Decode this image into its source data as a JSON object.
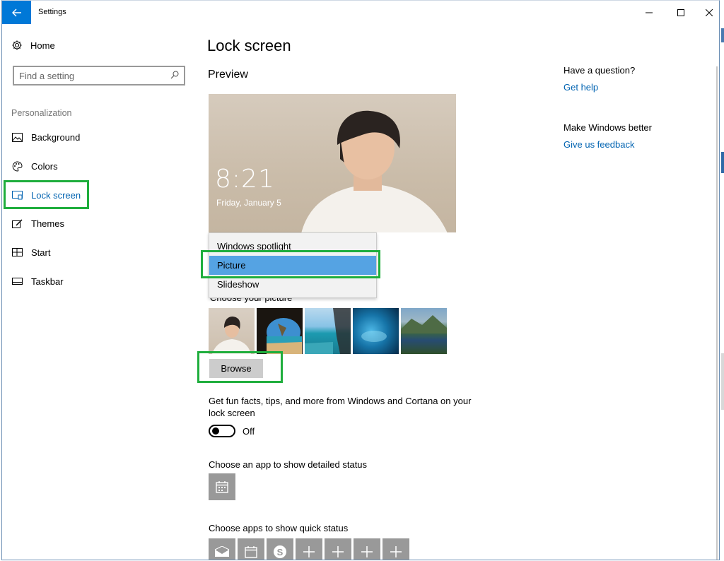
{
  "window": {
    "title": "Settings"
  },
  "sidebar": {
    "home_label": "Home",
    "search_placeholder": "Find a setting",
    "section_label": "Personalization",
    "items": [
      {
        "label": "Background",
        "icon": "picture-icon"
      },
      {
        "label": "Colors",
        "icon": "palette-icon"
      },
      {
        "label": "Lock screen",
        "icon": "lock-screen-icon",
        "active": true
      },
      {
        "label": "Themes",
        "icon": "brush-icon"
      },
      {
        "label": "Start",
        "icon": "start-icon"
      },
      {
        "label": "Taskbar",
        "icon": "taskbar-icon"
      }
    ]
  },
  "main": {
    "page_title": "Lock screen",
    "preview_label": "Preview",
    "preview_time": "8:21",
    "preview_date": "Friday, January 5",
    "background_dropdown": {
      "options": [
        "Windows spotlight",
        "Picture",
        "Slideshow"
      ],
      "selected": "Picture"
    },
    "choose_picture_label": "Choose your picture",
    "browse_label": "Browse",
    "tips_text": "Get fun facts, tips, and more from Windows and Cortana on your lock screen",
    "tips_toggle_state": "Off",
    "detailed_status_label": "Choose an app to show detailed status",
    "quick_status_label": "Choose apps to show quick status"
  },
  "help": {
    "question": "Have a question?",
    "get_help": "Get help",
    "make_better": "Make Windows better",
    "feedback": "Give us feedback"
  },
  "colors": {
    "accent": "#0078d7",
    "link": "#0063b1",
    "highlight_box": "#1fae3d",
    "selected_option": "#55a3e3"
  }
}
